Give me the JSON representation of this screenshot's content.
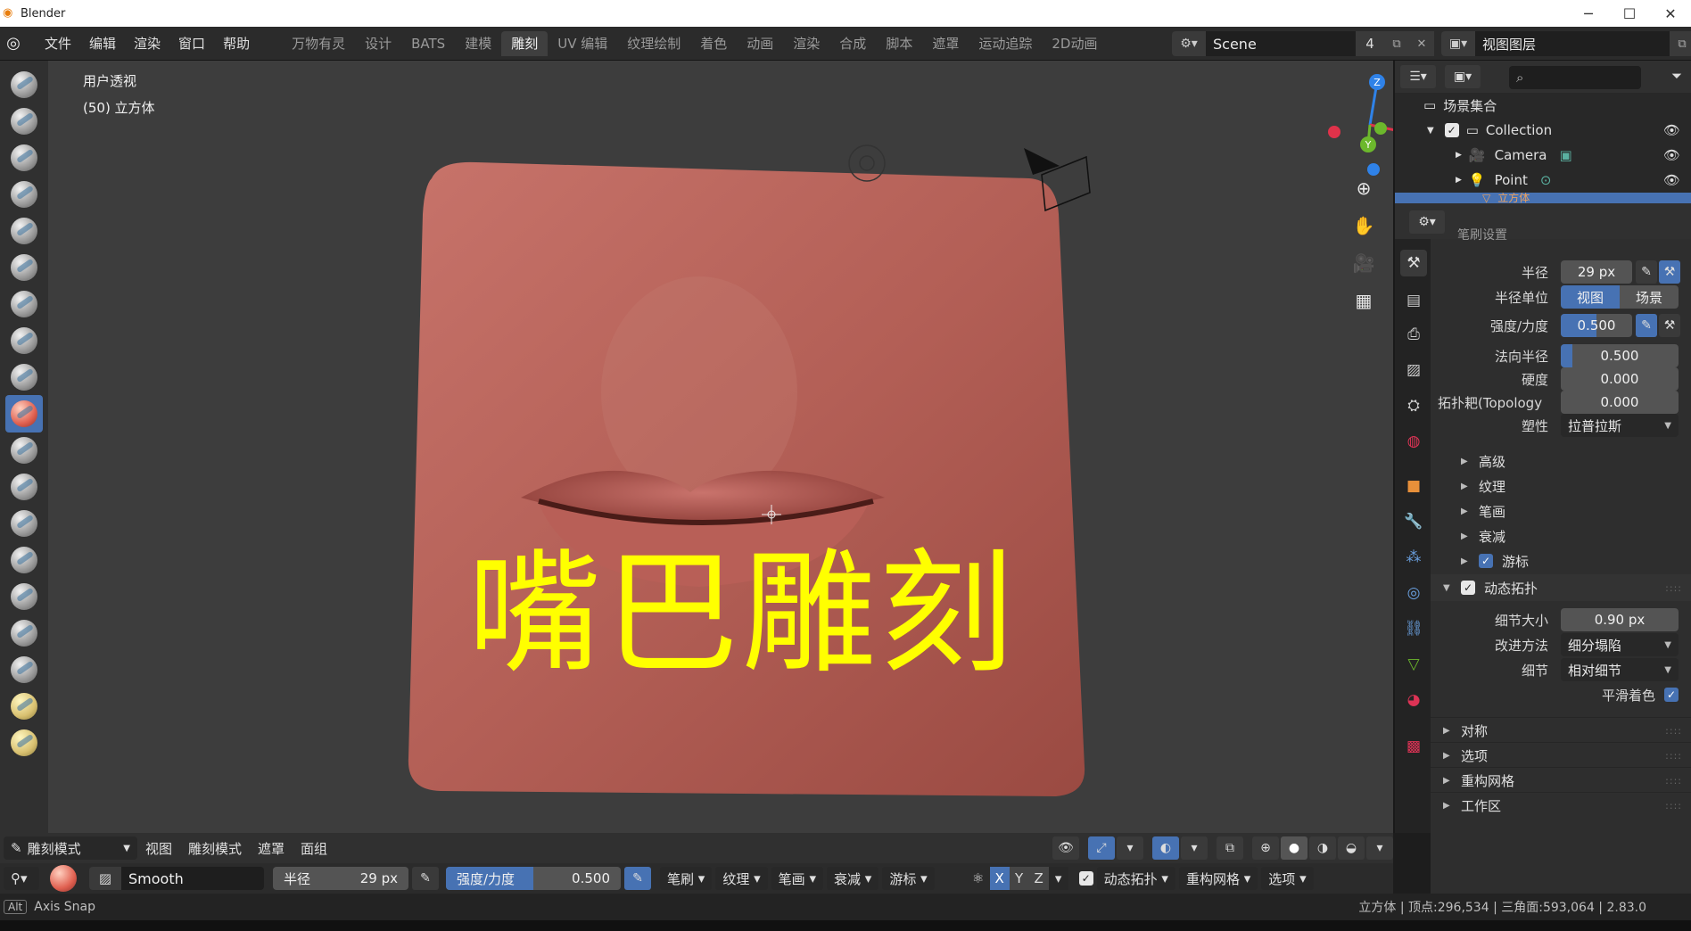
{
  "window": {
    "title": "Blender"
  },
  "menu": [
    "文件",
    "编辑",
    "渲染",
    "窗口",
    "帮助"
  ],
  "workspaces": [
    "万物有灵",
    "设计",
    "BATS",
    "建模",
    "雕刻",
    "UV 编辑",
    "纹理绘制",
    "着色",
    "动画",
    "渲染",
    "合成",
    "脚本",
    "遮罩",
    "运动追踪",
    "2D动画"
  ],
  "active_workspace_index": 4,
  "scene": {
    "name": "Scene",
    "users": "4"
  },
  "view_layer": {
    "name": "视图图层"
  },
  "viewport": {
    "view_name": "用户透视",
    "object_info": "(50) 立方体",
    "overlay_title": "嘴巴雕刻",
    "gizmo_axes": {
      "x": "X",
      "y": "Y",
      "z": "Z"
    }
  },
  "header": {
    "mode": "雕刻模式",
    "items": [
      "视图",
      "雕刻模式",
      "遮罩",
      "面组"
    ]
  },
  "tool_settings": {
    "brush_name": "Smooth",
    "radius_label": "半径",
    "radius_value": "29 px",
    "strength_label": "强度/力度",
    "strength_value": "0.500",
    "strength_fraction": 0.5,
    "dropdowns": [
      "笔刷",
      "纹理",
      "笔画",
      "衰减",
      "游标"
    ],
    "axes": [
      "X",
      "Y",
      "Z"
    ],
    "dyntopo_label": "动态拓扑",
    "remesh_label": "重构网格",
    "options_label": "选项"
  },
  "status": {
    "key": "Alt",
    "hint": "Axis Snap",
    "stats": "立方体 | 顶点:296,534 | 三角面:593,064 | 2.83.0"
  },
  "outliner": {
    "root": "场景集合",
    "rows": [
      {
        "name": "Collection"
      },
      {
        "name": "Camera"
      },
      {
        "name": "Point"
      },
      {
        "name": "立方体"
      }
    ]
  },
  "properties": {
    "partial_header": "笔刷设置",
    "radius_label": "半径",
    "radius_value": "29 px",
    "radius_unit_label": "半径单位",
    "radius_unit_options": [
      "视图",
      "场景"
    ],
    "strength_label": "强度/力度",
    "strength_value": "0.500",
    "strength_fraction": 0.5,
    "normal_radius_label": "法向半径",
    "normal_radius_value": "0.500",
    "normal_radius_fraction": 0.1,
    "hardness_label": "硬度",
    "hardness_value": "0.000",
    "topology_label": "拓扑耙(Topology",
    "topology_value": "0.000",
    "plasticity_label": "塑性",
    "plasticity_value": "拉普拉斯",
    "subsections": [
      "高级",
      "纹理",
      "笔画",
      "衰减"
    ],
    "cursor_label": "游标",
    "dyntopo_section": "动态拓扑",
    "detail_size_label": "细节大小",
    "detail_size_value": "0.90 px",
    "refine_label": "改进方法",
    "refine_value": "细分塌陷",
    "detail_label": "细节",
    "detail_value": "相对细节",
    "smooth_shading_label": "平滑着色",
    "bottom_sections": [
      "对称",
      "选项",
      "重构网格",
      "工作区"
    ]
  },
  "colors": {
    "accent": "#4772b3",
    "overlay_text": "#ffff00",
    "clay": "#b8645a",
    "axis_x": "#e0324a",
    "axis_y": "#6cb82c",
    "axis_z": "#2f82e8"
  }
}
